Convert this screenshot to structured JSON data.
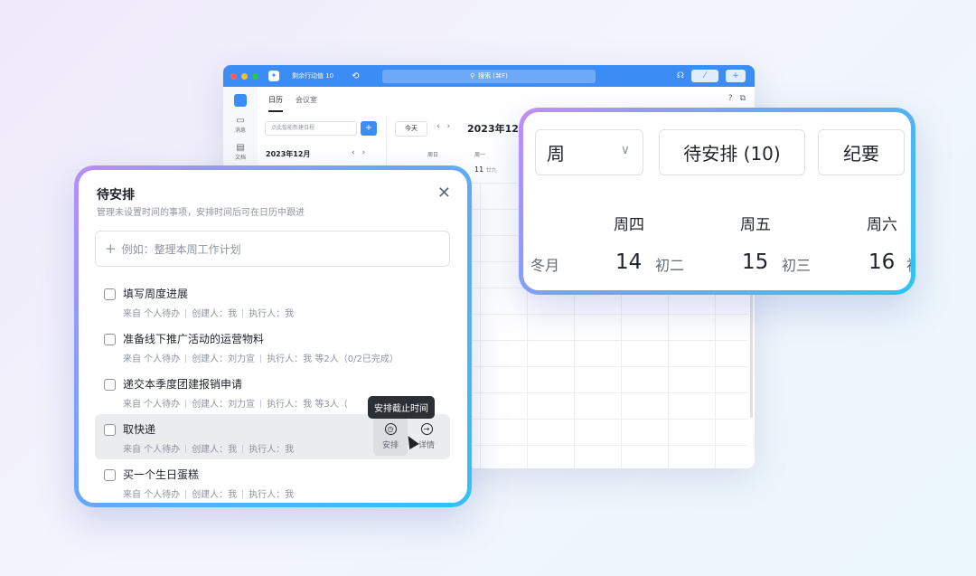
{
  "app": {
    "vitality": "剩余行动值 10",
    "search_placeholder": "搜索 (⌘F)",
    "sidebar": [
      {
        "label": "消息"
      },
      {
        "label": "文档"
      }
    ],
    "tabs": [
      "日历",
      "会议室"
    ],
    "mini_input_placeholder": "点此智能新建日程",
    "mini_month": "2023年12月",
    "today": "今天",
    "cal_month": "2023年12月",
    "columns": [
      {
        "head": "周日",
        "date": ""
      },
      {
        "head": "周一",
        "date": "11",
        "lunar": "廿九"
      }
    ]
  },
  "popup": {
    "title": "待安排",
    "subtitle": "管理未设置时间的事项，安排时间后可在日历中跟进",
    "input_placeholder": "例如：整理本周工作计划",
    "tasks": [
      {
        "title": "填写周度进展",
        "source": "来自 个人待办",
        "creator": "创建人：我",
        "assignee": "执行人：我"
      },
      {
        "title": "准备线下推广活动的运营物料",
        "source": "来自 个人待办",
        "creator": "创建人：刘力宣",
        "assignee": "执行人：我 等2人（0/2已完成）"
      },
      {
        "title": "递交本季度团建报销申请",
        "source": "来自 个人待办",
        "creator": "创建人：刘力宣",
        "assignee": "执行人：我 等3人（"
      },
      {
        "title": "取快递",
        "source": "来自 个人待办",
        "creator": "创建人：我",
        "assignee": "执行人：我"
      },
      {
        "title": "买一个生日蛋糕",
        "source": "来自 个人待办",
        "creator": "创建人：我",
        "assignee": "执行人：我"
      }
    ],
    "tooltip": "安排截止时间",
    "action_schedule": "安排",
    "action_detail": "详情"
  },
  "zoom": {
    "view_select": "周",
    "pending": "待安排 (10)",
    "minutes": "纪要",
    "weekdays": [
      "周四",
      "周五",
      "周六"
    ],
    "lunar_month": "冬月",
    "days": [
      {
        "num": "14",
        "lunar": "初二"
      },
      {
        "num": "15",
        "lunar": "初三"
      },
      {
        "num": "16",
        "lunar": "初"
      }
    ]
  },
  "colors": {
    "accent": "#3c8cf5",
    "gradient_start": "#b88ef6",
    "gradient_end": "#2ec3f6"
  }
}
